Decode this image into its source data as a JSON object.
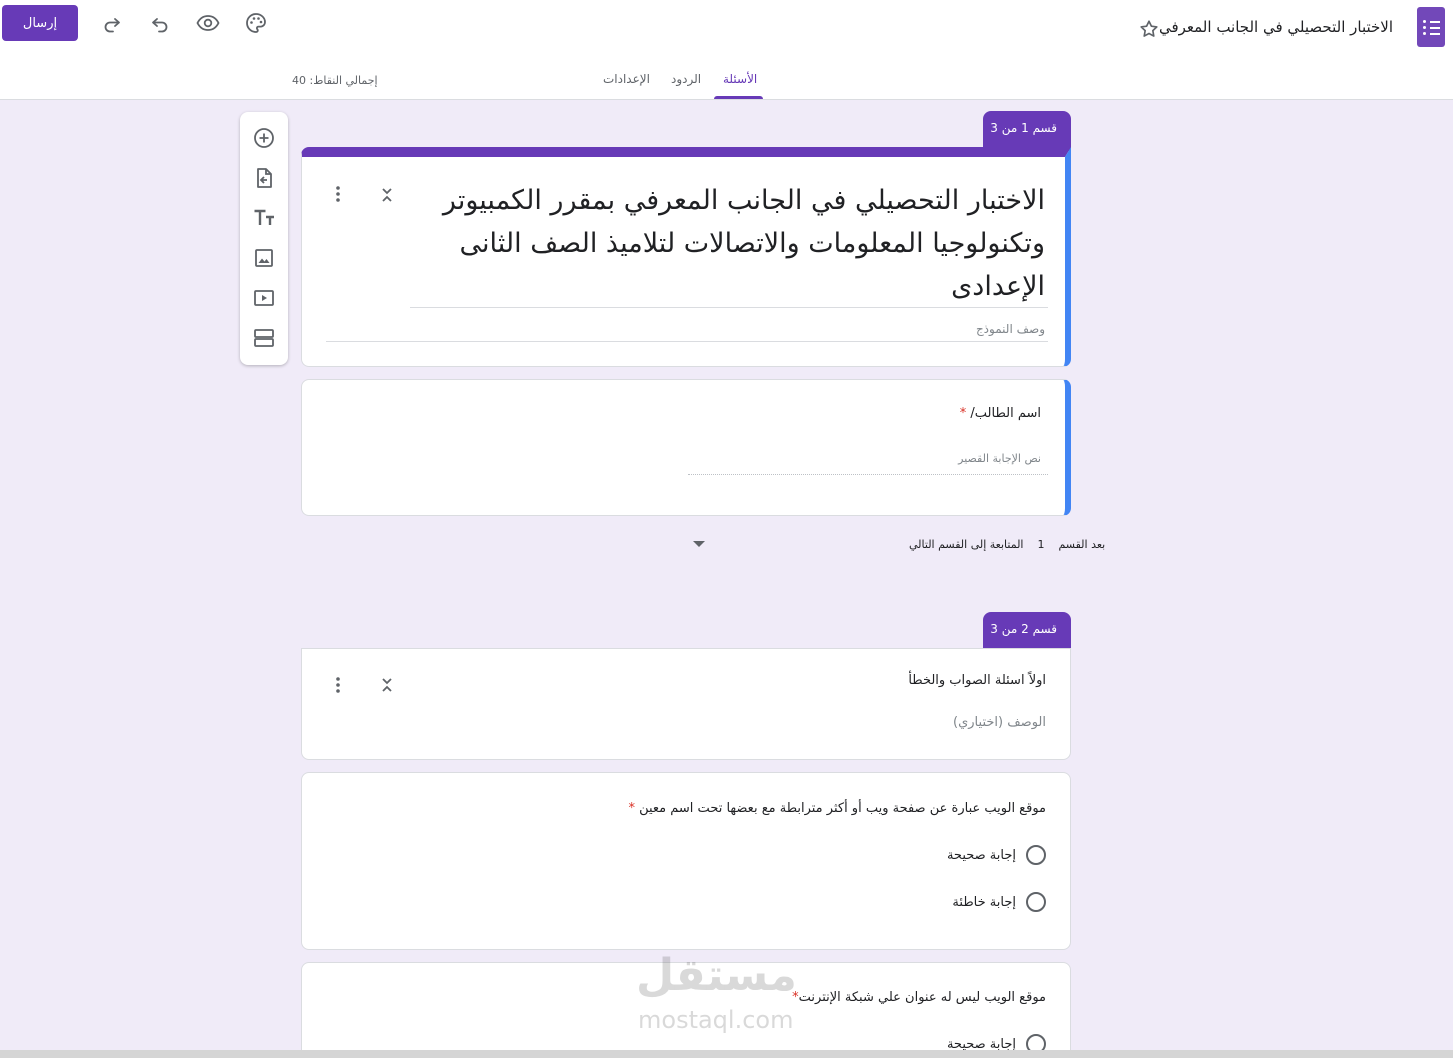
{
  "header": {
    "doc_title": "الاختبار التحصيلي في الجانب المعرفي",
    "send_label": "إرسال",
    "tabs": [
      {
        "label": "الأسئلة",
        "active": true
      },
      {
        "label": "الردود",
        "active": false
      },
      {
        "label": "الإعدادات",
        "active": false
      }
    ],
    "total_points": "إجمالي النقاط: 40"
  },
  "colors": {
    "accent": "#673ab7",
    "focus": "#4285f4",
    "background": "#f0ebf8",
    "required": "#d93025"
  },
  "toolbar": {
    "items": [
      "add-question-icon",
      "import-questions-icon",
      "add-title-icon",
      "add-image-icon",
      "add-video-icon",
      "add-section-icon"
    ]
  },
  "section1": {
    "tab_label": "قسم 1 من 3",
    "form_title": "الاختبار التحصيلي في الجانب المعرفي بمقرر الكمبيوتر وتكنولوجيا المعلومات والاتصالات لتلاميذ الصف الثانى الإعدادى",
    "form_description_placeholder": "وصف النموذج",
    "question": {
      "text": "اسم الطالب/",
      "required_mark": "*",
      "answer_placeholder": "نص الإجابة القصير"
    },
    "after_section": {
      "label": "بعد القسم",
      "number": "1",
      "value": "المتابعة إلى القسم التالي"
    }
  },
  "section2": {
    "tab_label": "قسم 2 من 3",
    "title": "اولاً اسئلة الصواب والخطأ",
    "description_placeholder": "الوصف (اختياري)",
    "questions": [
      {
        "text": "موقع الويب عبارة عن صفحة ويب أو أكثر مترابطة مع بعضها تحت اسم معين",
        "required_mark": "*",
        "options": [
          "إجابة صحيحة",
          "إجابة خاطئة"
        ]
      },
      {
        "text": "موقع الويب ليس له عنوان علي شبكة الإنترنت",
        "required_mark": "*",
        "options": [
          "إجابة صحيحة"
        ]
      }
    ]
  },
  "watermark": {
    "arabic": "مستقل",
    "latin": "mostaql.com"
  }
}
